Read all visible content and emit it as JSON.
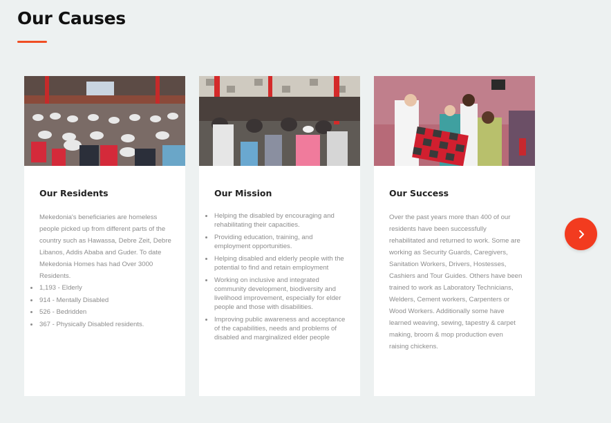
{
  "section": {
    "title": "Our Causes"
  },
  "accent_color": "#f04e23",
  "cards": [
    {
      "title": "Our Residents",
      "image_desc": "crowd-seated-photo",
      "intro": "Mekedonia's beneficiaries are homeless people picked up from different parts of the country such as Hawassa, Debre Zeit, Debre Libanos, Addis Ababa and Guder. To date Mekedonia Homes has had Over 3000 Residents.",
      "items": [
        "1,193 - Elderly",
        "914 - Mentally Disabled",
        "526 - Bedridden",
        "367 - Physically Disabled residents."
      ]
    },
    {
      "title": "Our Mission",
      "image_desc": "elderly-gathering-photo",
      "items": [
        "Helping the disabled by encouraging and rehabilitating their capacities.",
        "Providing education, training, and employment opportunities.",
        "Helping disabled and elderly people with the potential to find and retain employment",
        "Working on inclusive and integrated community development, biodiversity and livelihood improvement, especially for elder people and those with disabilities.",
        "Improving public awareness and acceptance of the capabilities, needs and problems of disabled and marginalized elder people"
      ]
    },
    {
      "title": "Our Success",
      "image_desc": "group-holding-quilt-photo",
      "body": "Over the past years more than 400 of our residents have been successfully rehabilitated and returned to work. Some are working as Security Guards, Caregivers, Sanitation Workers, Drivers, Hostesses, Cashiers and Tour Guides. Others have been trained to work as Laboratory Technicians, Welders, Cement workers, Carpenters or Wood Workers. Additionally some have learned weaving, sewing, tapestry & carpet making, broom & mop production even raising chickens."
    }
  ],
  "carousel": {
    "next_icon": "chevron-right-icon"
  }
}
